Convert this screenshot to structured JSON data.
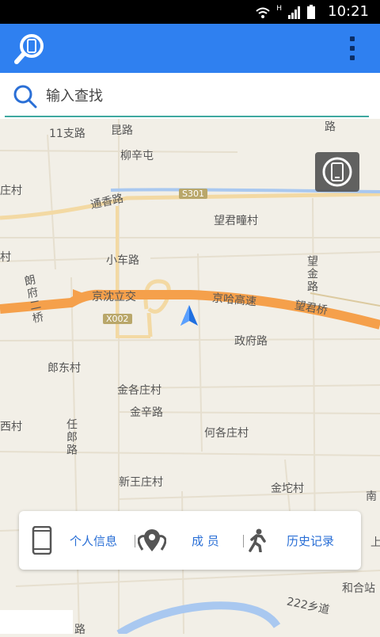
{
  "status_bar": {
    "time": "10:21",
    "network_label": "H"
  },
  "app_bar": {
    "logo_icon": "phone-search-icon",
    "menu_icon": "overflow-menu-icon"
  },
  "search": {
    "placeholder": "输入查找",
    "value": ""
  },
  "map": {
    "labels": {
      "l1": "11支路",
      "l2": "柳辛屯",
      "l3": "庄村",
      "l4": "通香路",
      "l5": "望君疃村",
      "l6": "小车路",
      "l7": "京沈立交",
      "l8": "京哈高速",
      "l9": "望君桥",
      "l10": "政府路",
      "l11": "郎东村",
      "l12": "金各庄村",
      "l13": "金辛路",
      "l14": "何各庄村",
      "l15": "西村",
      "l16": "新王庄村",
      "l17": "金坨村",
      "l18": "南",
      "l19": "上",
      "l20": "和合站",
      "l21": "222乡道",
      "l22": "望金路",
      "l23": "朗府二桥",
      "l24": "任郎路",
      "l25": "路",
      "l26": "村",
      "l27": "路",
      "l28": "路",
      "l29": "昆路"
    },
    "road_signs": {
      "s301": "S301",
      "x002": "X002"
    },
    "colors": {
      "highway": "#f5a04b",
      "river": "#a9c8f0",
      "map_bg": "#f2efe7",
      "accent": "#2f80f0"
    }
  },
  "bottom_panel": {
    "personal_info": "个人信息",
    "members": "成 员",
    "history": "历史记录"
  }
}
